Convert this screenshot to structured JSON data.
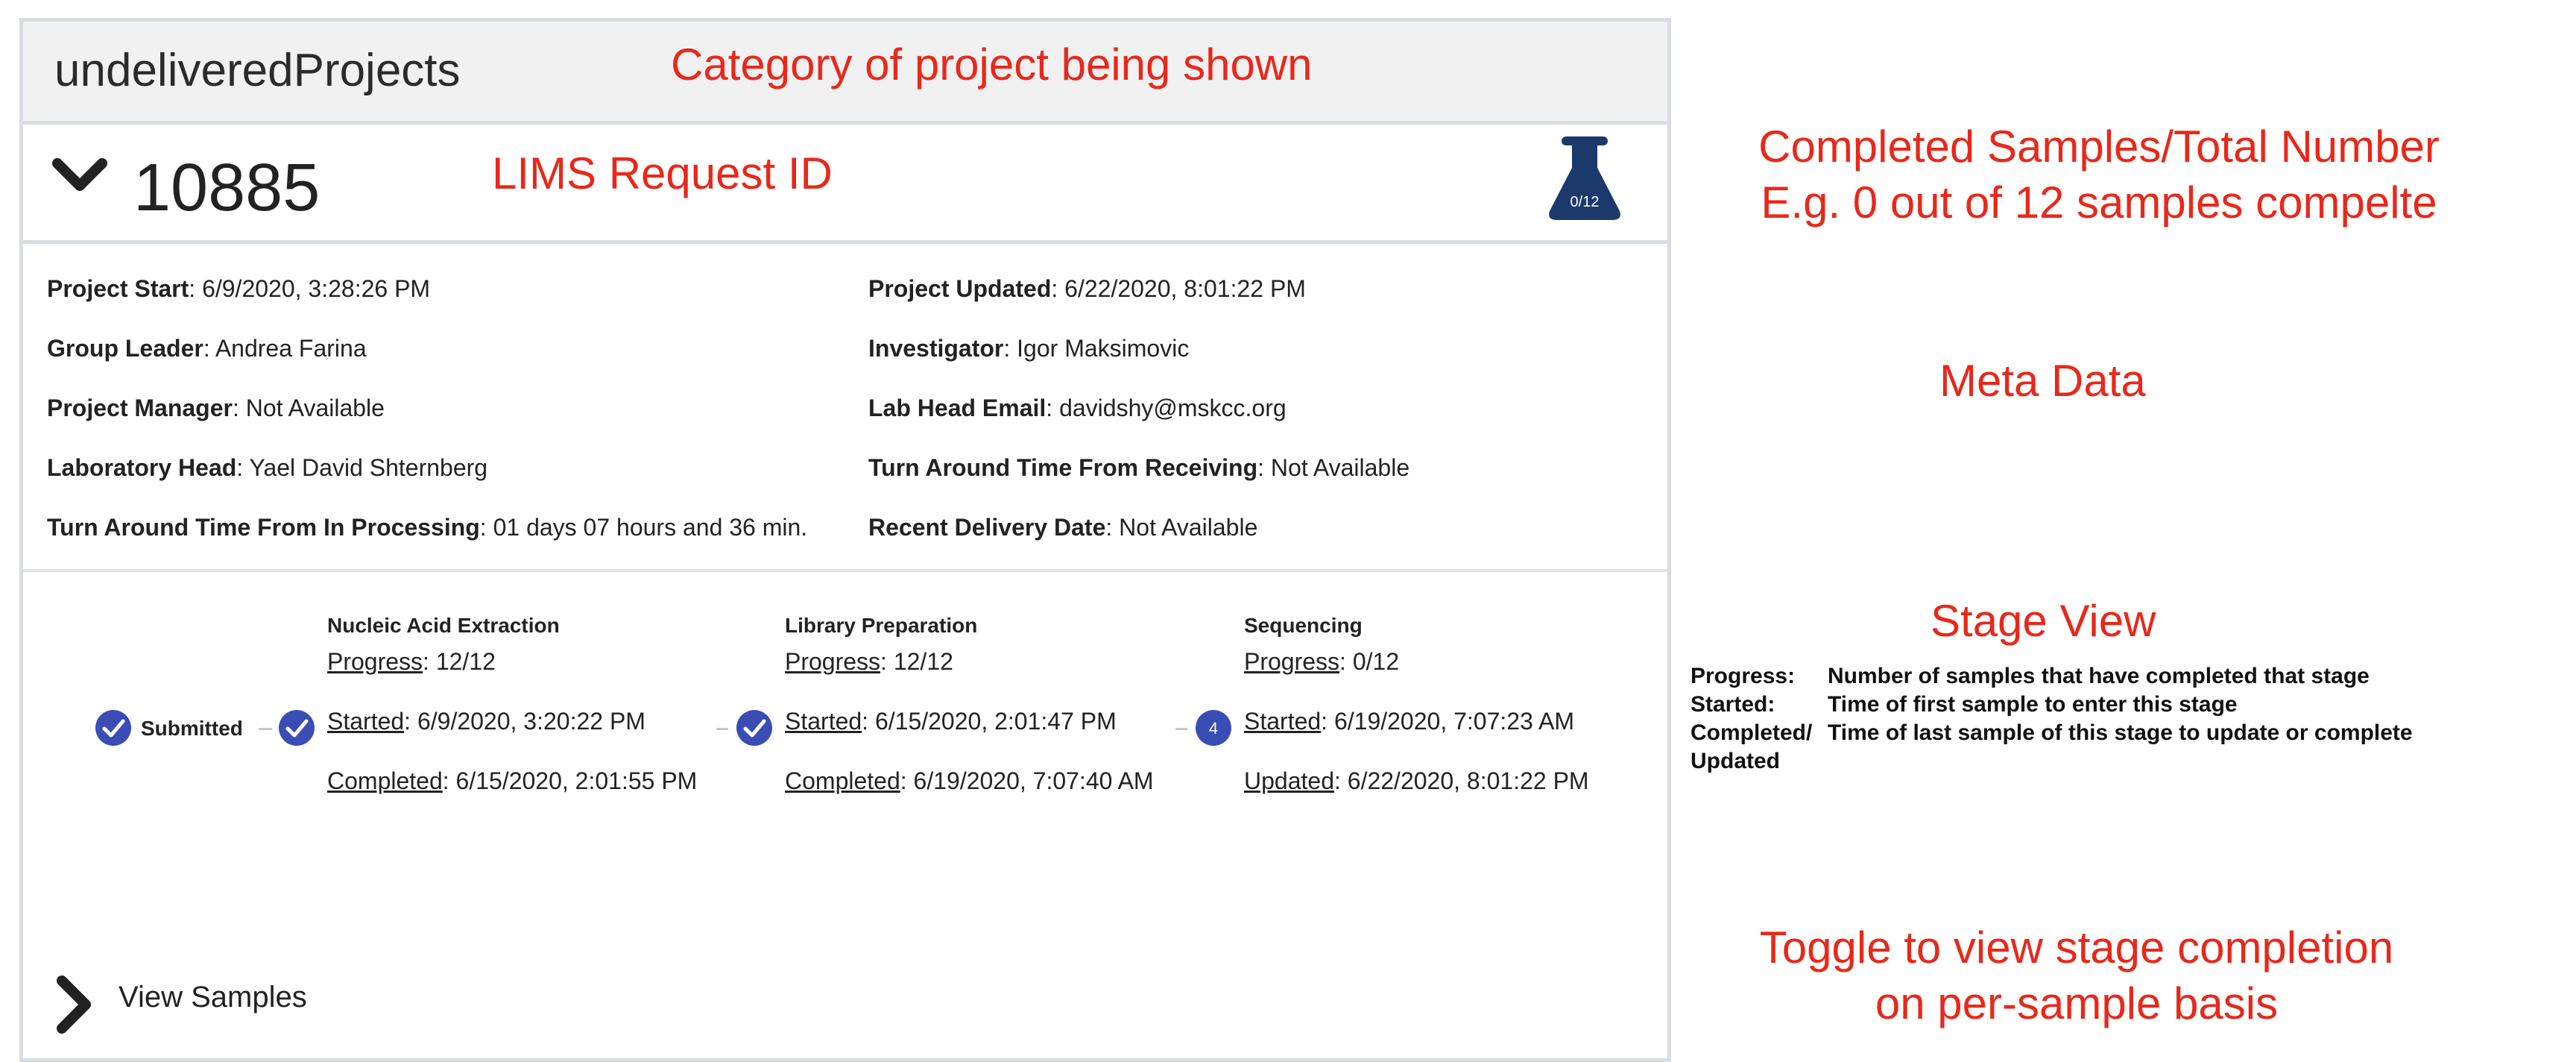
{
  "category": {
    "title": "undeliveredProjects"
  },
  "project": {
    "id": "10885",
    "sample_progress": "0/12"
  },
  "meta": {
    "left": [
      {
        "label": "Project Start",
        "value": ": 6/9/2020, 3:28:26 PM"
      },
      {
        "label": "Group Leader",
        "value": ": Andrea Farina"
      },
      {
        "label": "Project Manager",
        "value": ": Not Available"
      },
      {
        "label": "Laboratory Head",
        "value": ": Yael David Shternberg"
      },
      {
        "label": "Turn Around Time From In Processing",
        "value": ": 01 days 07 hours and 36 min."
      }
    ],
    "right": [
      {
        "label": "Project Updated",
        "value": ": 6/22/2020, 8:01:22 PM"
      },
      {
        "label": "Investigator",
        "value": ": Igor Maksimovic"
      },
      {
        "label": "Lab Head Email",
        "value": ": davidshy@mskcc.org"
      },
      {
        "label": "Turn Around Time From Receiving",
        "value": ": Not Available"
      },
      {
        "label": "Recent Delivery Date",
        "value": ": Not Available"
      }
    ]
  },
  "stages": {
    "submitted_label": "Submitted",
    "list": [
      {
        "name": "Nucleic Acid Extraction",
        "progress_label": "Progress",
        "progress_value": ": 12/12",
        "started_label": "Started",
        "started_value": ": 6/9/2020, 3:20:22 PM",
        "end_label": "Completed",
        "end_value": ": 6/15/2020, 2:01:55 PM"
      },
      {
        "name": "Library Preparation",
        "progress_label": "Progress",
        "progress_value": ": 12/12",
        "started_label": "Started",
        "started_value": ": 6/15/2020, 2:01:47 PM",
        "end_label": "Completed",
        "end_value": ": 6/19/2020, 7:07:40 AM"
      },
      {
        "name": "Sequencing",
        "step_number": "4",
        "progress_label": "Progress",
        "progress_value": ": 0/12",
        "started_label": "Started",
        "started_value": ": 6/19/2020, 7:07:23 AM",
        "end_label": "Updated",
        "end_value": ": 6/22/2020, 8:01:22 PM"
      }
    ]
  },
  "view_samples_label": "View Samples",
  "annotations": {
    "category": "Category of project being shown",
    "lims": "LIMS Request ID",
    "completed_line1": "Completed Samples/Total Number",
    "completed_line2": "E.g. 0 out of 12 samples compelte",
    "meta": "Meta Data",
    "stage_view": "Stage View",
    "toggle_line1": "Toggle to view stage completion",
    "toggle_line2": "on per-sample basis",
    "legend": [
      {
        "term": "Progress:",
        "desc": "Number of samples that have completed that stage"
      },
      {
        "term": "Started:",
        "desc": "Time of first sample to enter this stage"
      },
      {
        "term": "Completed/",
        "desc": "Time of last sample of this stage to update or complete"
      },
      {
        "term": "Updated",
        "desc": ""
      }
    ]
  },
  "colors": {
    "accent": "#3a4db4",
    "flask": "#1b3a6b",
    "annotation": "#e8281b"
  }
}
